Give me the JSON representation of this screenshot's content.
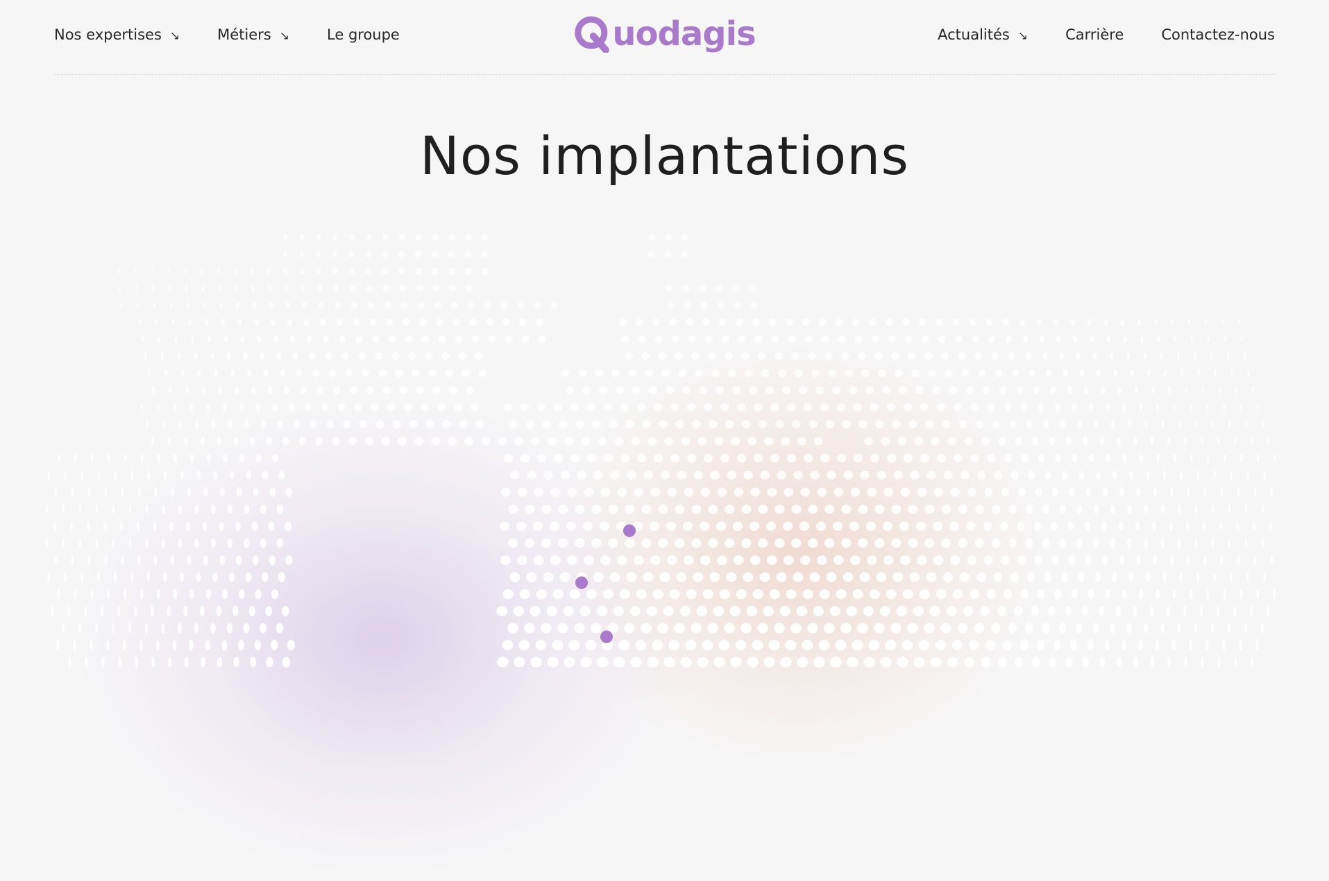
{
  "nav_left": [
    {
      "label": "Nos expertises",
      "has_dropdown": true
    },
    {
      "label": "Métiers",
      "has_dropdown": true
    },
    {
      "label": "Le groupe",
      "has_dropdown": false
    }
  ],
  "nav_right": [
    {
      "label": "Actualités",
      "has_dropdown": true
    },
    {
      "label": "Carrière",
      "has_dropdown": false
    },
    {
      "label": "Contactez-nous",
      "has_dropdown": false
    }
  ],
  "dropdown_glyph": "↘",
  "logo": {
    "text": "uodagis",
    "color": "#a97acc"
  },
  "hero": {
    "title": "Nos implantations"
  },
  "colors": {
    "background": "#f6f6f6",
    "accent": "#a97acc",
    "text": "#1f1f1f",
    "dot": "#ffffff"
  },
  "map_markers": [
    {
      "name": "location-marker-1"
    },
    {
      "name": "location-marker-2"
    },
    {
      "name": "location-marker-3"
    }
  ]
}
